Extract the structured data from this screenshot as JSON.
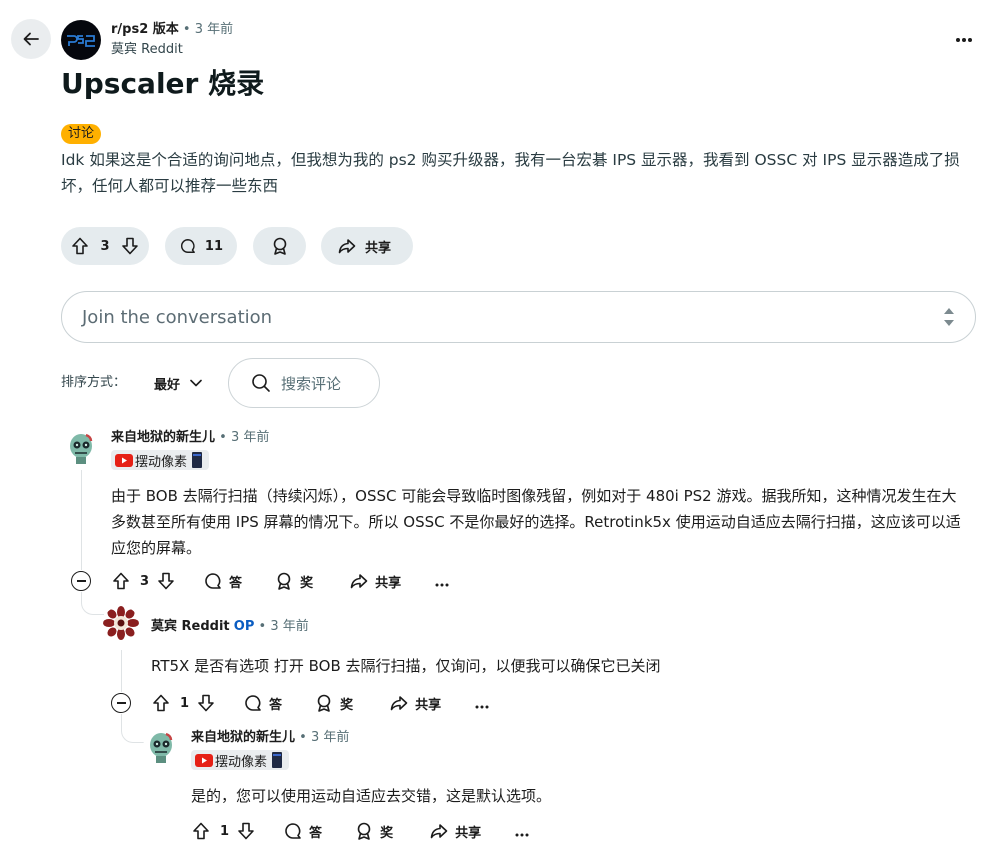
{
  "post": {
    "subreddit": "r/ps2 版本",
    "time": "3 年前",
    "author": "莫宾 Reddit",
    "title": "Upscaler 烧录",
    "flair": "讨论",
    "body": "Idk 如果这是个合适的询问地点，但我想为我的 ps2 购买升级器，我有一台宏碁 IPS 显示器，我看到 OSSC 对 IPS 显示器造成了损坏，任何人都可以推荐一些东西",
    "votes": "3",
    "comments_count": "11",
    "share_label": "共享",
    "accent_color": "#ffb000"
  },
  "composer": {
    "placeholder": "Join the conversation"
  },
  "sort": {
    "label": "排序方式：",
    "value": "最好",
    "search_placeholder": "搜索评论"
  },
  "comments": [
    {
      "author": "来自地狱的新生儿",
      "time": "3 年前",
      "flair": "摆动像素",
      "body": "由于 BOB 去隔行扫描（持续闪烁），OSSC 可能会导致临时图像残留，例如对于 480i PS2 游戏。据我所知，这种情况发生在大多数甚至所有使用 IPS 屏幕的情况下。所以 OSSC 不是你最好的选择。Retrotink5x 使用运动自适应去隔行扫描，这应该可以适应您的屏幕。",
      "votes": "3",
      "reply_label": "答",
      "award_label": "奖",
      "share_label": "共享"
    },
    {
      "author": "莫宾 Reddit",
      "op_label": "OP",
      "time": "3 年前",
      "body": "RT5X 是否有选项 打开 BOB 去隔行扫描，仅询问，以便我可以确保它已关闭",
      "votes": "1",
      "reply_label": "答",
      "award_label": "奖",
      "share_label": "共享"
    },
    {
      "author": "来自地狱的新生儿",
      "time": "3 年前",
      "flair": "摆动像素",
      "body": "是的，您可以使用运动自适应去交错，这是默认选项。",
      "votes": "1",
      "reply_label": "答",
      "award_label": "奖",
      "share_label": "共享"
    }
  ],
  "colors": {
    "op": "#0a5dc2",
    "meta": "#576f76",
    "pill_bg": "#e5ebee"
  }
}
